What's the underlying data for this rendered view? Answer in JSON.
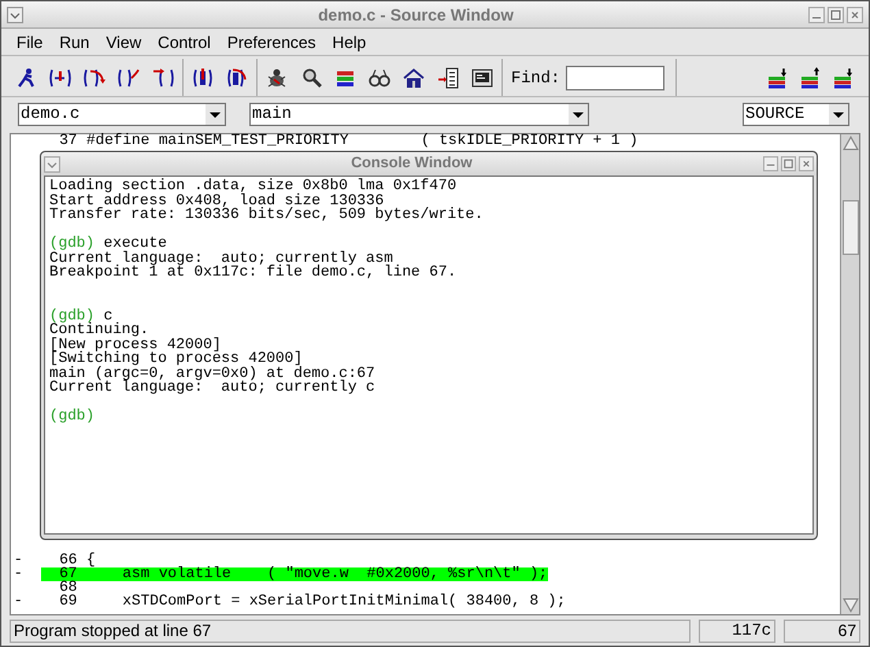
{
  "window": {
    "title": "demo.c - Source Window"
  },
  "menu": [
    "File",
    "Run",
    "View",
    "Control",
    "Preferences",
    "Help"
  ],
  "toolbar": {
    "find_label": "Find:"
  },
  "selectors": {
    "file": "demo.c",
    "function": "main",
    "mode": "SOURCE"
  },
  "source_top": [
    {
      "number": "37",
      "code": "#define mainSEM_TEST_PRIORITY        ( tskIDLE_PRIORITY + 1 )",
      "current": false
    }
  ],
  "source_bottom": [
    {
      "marker": "-",
      "number": "66",
      "code": "{",
      "current": false
    },
    {
      "marker": "-",
      "number": "67",
      "code": "    asm volatile    ( \"move.w  #0x2000, %sr\\n\\t\" );",
      "current": true
    },
    {
      "number": "68",
      "current": false
    },
    {
      "marker": "-",
      "number": "69",
      "code": "    xSTDComPort = xSerialPortInitMinimal( 38400, 8 );",
      "current": false
    }
  ],
  "console": {
    "title": "Console Window",
    "lines": [
      {
        "kind": "output",
        "text": "Loading section .data, size 0x8b0 lma 0x1f470"
      },
      {
        "kind": "output",
        "text": "Start address 0x408, load size 130336"
      },
      {
        "kind": "output",
        "text": "Transfer rate: 130336 bits/sec, 509 bytes/write."
      },
      {
        "kind": "blank"
      },
      {
        "kind": "prompt",
        "prompt": "(gdb)",
        "command": "execute"
      },
      {
        "kind": "output",
        "text": "Current language:  auto; currently asm"
      },
      {
        "kind": "output",
        "text": "Breakpoint 1 at 0x117c: file demo.c, line 67."
      },
      {
        "kind": "blank"
      },
      {
        "kind": "blank"
      },
      {
        "kind": "prompt",
        "prompt": "(gdb)",
        "command": "c"
      },
      {
        "kind": "output",
        "text": "Continuing."
      },
      {
        "kind": "output",
        "text": "[New process 42000]"
      },
      {
        "kind": "output",
        "text": "[Switching to process 42000]"
      },
      {
        "kind": "output",
        "text": "main (argc=0, argv=0x0) at demo.c:67"
      },
      {
        "kind": "output",
        "text": "Current language:  auto; currently c"
      },
      {
        "kind": "blank"
      },
      {
        "kind": "prompt",
        "prompt": "(gdb)"
      }
    ]
  },
  "status_bar": {
    "message": "Program stopped at line 67",
    "address": "117c",
    "line": "67"
  }
}
